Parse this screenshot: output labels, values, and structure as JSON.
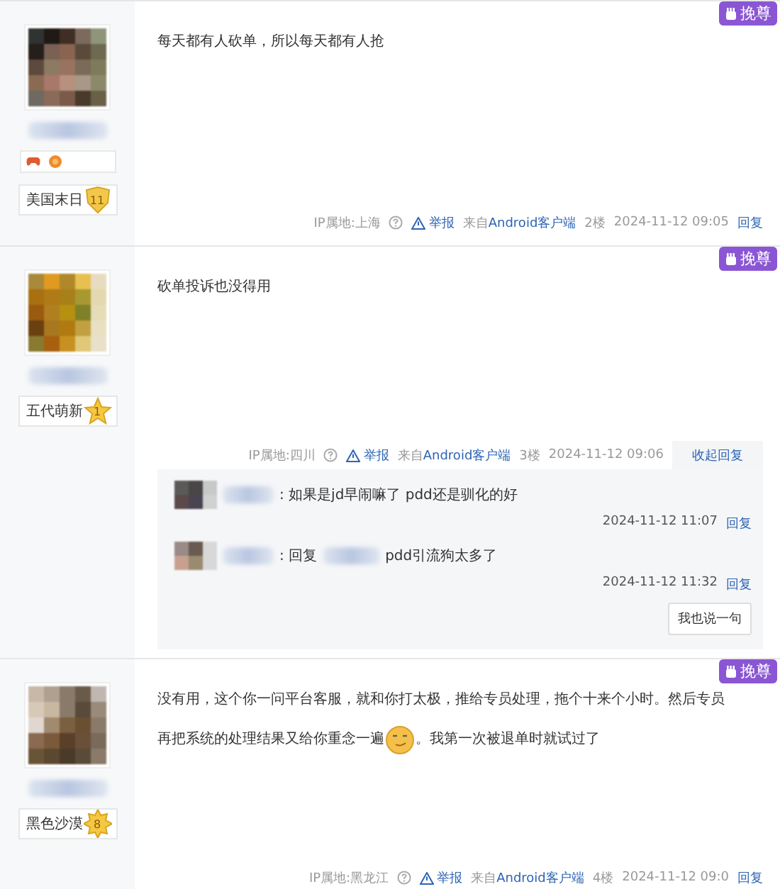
{
  "posts": [
    {
      "tag": "挽尊",
      "medals": true,
      "title": "美国末日",
      "level": {
        "kind": "shield",
        "value": "11"
      },
      "content": [
        {
          "parts": [
            {
              "kind": "text",
              "text": "每天都有人砍单，所以每天都有人抢"
            }
          ]
        }
      ],
      "footer": {
        "ip": "IP属地:上海",
        "report": "举报",
        "source_prefix": "来自",
        "source": "Android客户端",
        "floor": "2楼",
        "time": "2024-11-12 09:05",
        "reply": {
          "label": "回复",
          "expanded": false
        }
      }
    },
    {
      "tag": "挽尊",
      "medals": false,
      "title": "五代萌新",
      "level": {
        "kind": "star",
        "value": "1"
      },
      "content": [
        {
          "parts": [
            {
              "kind": "text",
              "text": "砍单投诉也没得用"
            }
          ]
        }
      ],
      "footer": {
        "ip": "IP属地:四川",
        "report": "举报",
        "source_prefix": "来自",
        "source": "Android客户端",
        "floor": "3楼",
        "time": "2024-11-12 09:06",
        "reply": {
          "label": "收起回复",
          "expanded": true
        }
      },
      "comments": [
        {
          "parts": [
            {
              "kind": "text",
              "text": ": 如果是jd早闹嘛了 pdd还是驯化的好"
            }
          ],
          "time": "2024-11-12 11:07",
          "reply": "回复"
        },
        {
          "parts": [
            {
              "kind": "text",
              "text": ": 回复"
            },
            {
              "kind": "blur"
            },
            {
              "kind": "text",
              "text": "pdd引流狗太多了"
            }
          ],
          "time": "2024-11-12 11:32",
          "reply": "回复"
        }
      ],
      "say_button": "我也说一句"
    },
    {
      "tag": "挽尊",
      "medals": false,
      "title": "黑色沙漠",
      "level": {
        "kind": "sun",
        "value": "8"
      },
      "content": [
        {
          "parts": [
            {
              "kind": "text",
              "text": "没有用，这个你一问平台客服，就和你打太极，推给专员处理，拖个十来个小时。然后专员"
            }
          ]
        },
        {
          "parts": [
            {
              "kind": "text",
              "text": "再把系统的处理结果又给你重念一遍"
            },
            {
              "kind": "emoji"
            },
            {
              "kind": "text",
              "text": "。我第一次被退单时就试过了"
            }
          ]
        }
      ],
      "footer": {
        "ip": "IP属地:黑龙江",
        "report": "举报",
        "source_prefix": "来自",
        "source": "Android客户端",
        "floor": "4楼",
        "time": "2024-11-12 09:0",
        "reply": {
          "label": "回复",
          "expanded": false
        }
      }
    }
  ]
}
